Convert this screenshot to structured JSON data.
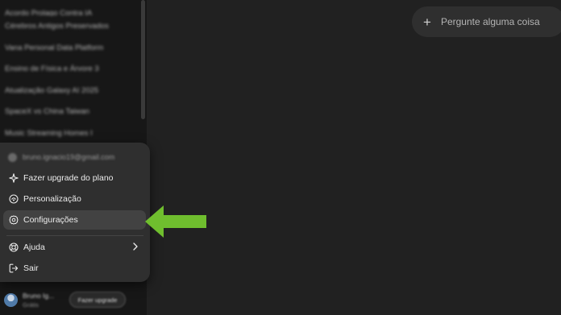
{
  "sidebar": {
    "history": [
      "Acordo Prolago Contra IA",
      "Cérebros Antigos Preservados",
      "Vana Personal Data Platform",
      "Ensino de Física e Árvore 3",
      "Atualização Galaxy AI 2025",
      "SpaceX vs China Taiwan",
      "Music Streaming Homes I"
    ]
  },
  "menu": {
    "email": "bruno.ignacio19@gmail.com",
    "items": [
      {
        "label": "Fazer upgrade do plano",
        "icon": "sparkle-icon"
      },
      {
        "label": "Personalização",
        "icon": "personalization-icon"
      },
      {
        "label": "Configurações",
        "icon": "settings-gear-icon"
      },
      {
        "label": "Ajuda",
        "icon": "help-lifebuoy-icon"
      },
      {
        "label": "Sair",
        "icon": "logout-icon"
      }
    ]
  },
  "user": {
    "name": "Bruno Ig...",
    "plan": "Grátis",
    "upgrade_label": "Fazer upgrade"
  },
  "main": {
    "ask_placeholder": "Pergunte alguma coisa"
  },
  "colors": {
    "annotation_arrow": "#6fbe2e",
    "active_item": "#424242"
  }
}
